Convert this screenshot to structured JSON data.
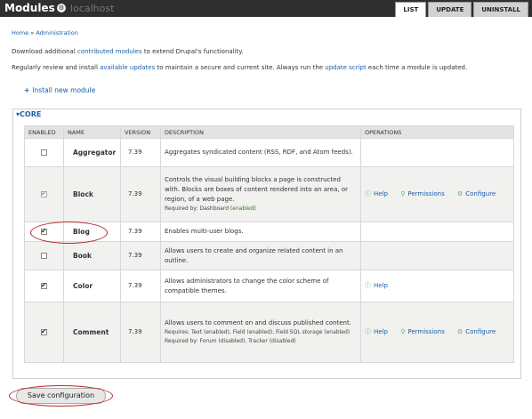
{
  "header": {
    "title": "Modules",
    "host": "localhost",
    "tabs": [
      "LIST",
      "UPDATE",
      "UNINSTALL"
    ]
  },
  "breadcrumb": [
    "Home",
    "Administration"
  ],
  "help": {
    "line1_pre": "Download additional ",
    "line1_link": "contributed modules",
    "line1_post": " to extend Drupal's functionality.",
    "line2_pre": "Regularly review and install ",
    "line2_link1": "available updates",
    "line2_mid": " to maintain a secure and current site. Always run the ",
    "line2_link2": "update script",
    "line2_post": " each time a module is updated."
  },
  "install_link": "Install new module",
  "section": "CORE",
  "columns": [
    "ENABLED",
    "NAME",
    "VERSION",
    "DESCRIPTION",
    "OPERATIONS"
  ],
  "modules": [
    {
      "name": "Aggregator",
      "version": "7.39",
      "enabled": false,
      "disabled": false,
      "description": "Aggregates syndicated content (RSS, RDF, and Atom feeds).",
      "operations": []
    },
    {
      "name": "Block",
      "version": "7.39",
      "enabled": true,
      "disabled": true,
      "description": "Controls the visual building blocks a page is constructed with. Blocks are boxes of content rendered into an area, or region, of a web page.",
      "required_by": "Required by: Dashboard (",
      "required_by_status": "enabled",
      "required_by_end": ")",
      "operations": [
        "Help",
        "Permissions",
        "Configure"
      ]
    },
    {
      "name": "Blog",
      "version": "7.39",
      "enabled": true,
      "disabled": false,
      "description": "Enables multi-user blogs.",
      "operations": []
    },
    {
      "name": "Book",
      "version": "7.39",
      "enabled": false,
      "disabled": false,
      "description": "Allows users to create and organize related content in an outline.",
      "operations": []
    },
    {
      "name": "Color",
      "version": "7.39",
      "enabled": true,
      "disabled": false,
      "description": "Allows administrators to change the color scheme of compatible themes.",
      "operations": [
        "Help"
      ]
    },
    {
      "name": "Comment",
      "version": "7.39",
      "enabled": true,
      "disabled": false,
      "description": "Allows users to comment on and discuss published content.",
      "requires": "Requires: Text (enabled), Field (enabled), Field SQL storage (enabled)",
      "required_by": "Required by: Forum (disabled), Tracker (disabled)",
      "operations": [
        "Help",
        "Permissions",
        "Configure"
      ]
    }
  ],
  "save_button": "Save configuration",
  "colors": {
    "link": "#1b5fa8",
    "enabled": "#2e7d1f",
    "disabled": "#a33",
    "highlight": "#b52a2a"
  },
  "icons": {
    "ops_help": "help-icon",
    "ops_permissions": "key-icon",
    "ops_configure": "gear-icon"
  }
}
